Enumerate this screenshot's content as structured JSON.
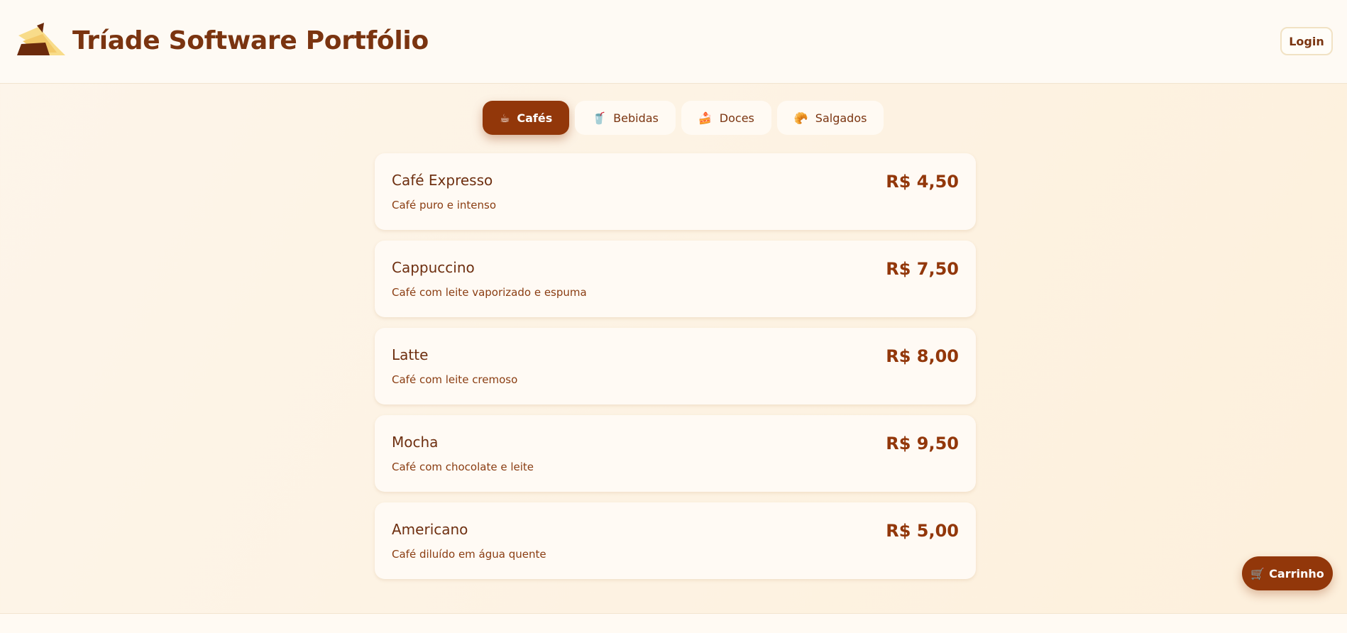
{
  "header": {
    "title": "Tríade Software Portfólio",
    "logo_icon": "triade-logo-icon",
    "login_label": "Login"
  },
  "tabs": [
    {
      "label": "Cafés",
      "icon": "☕",
      "active": true
    },
    {
      "label": "Bebidas",
      "icon": "🥤",
      "active": false
    },
    {
      "label": "Doces",
      "icon": "🍰",
      "active": false
    },
    {
      "label": "Salgados",
      "icon": "🥐",
      "active": false
    }
  ],
  "products": [
    {
      "name": "Café Expresso",
      "description": "Café puro e intenso",
      "price": "R$ 4,50"
    },
    {
      "name": "Cappuccino",
      "description": "Café com leite vaporizado e espuma",
      "price": "R$ 7,50"
    },
    {
      "name": "Latte",
      "description": "Café com leite cremoso",
      "price": "R$ 8,00"
    },
    {
      "name": "Mocha",
      "description": "Café com chocolate e leite",
      "price": "R$ 9,50"
    },
    {
      "name": "Americano",
      "description": "Café diluído em água quente",
      "price": "R$ 5,00"
    }
  ],
  "cart": {
    "label": "Carrinho",
    "icon": "🛒"
  },
  "colors": {
    "brand": "#92370a",
    "text": "#7a3410",
    "background": "#fdf3e4"
  }
}
